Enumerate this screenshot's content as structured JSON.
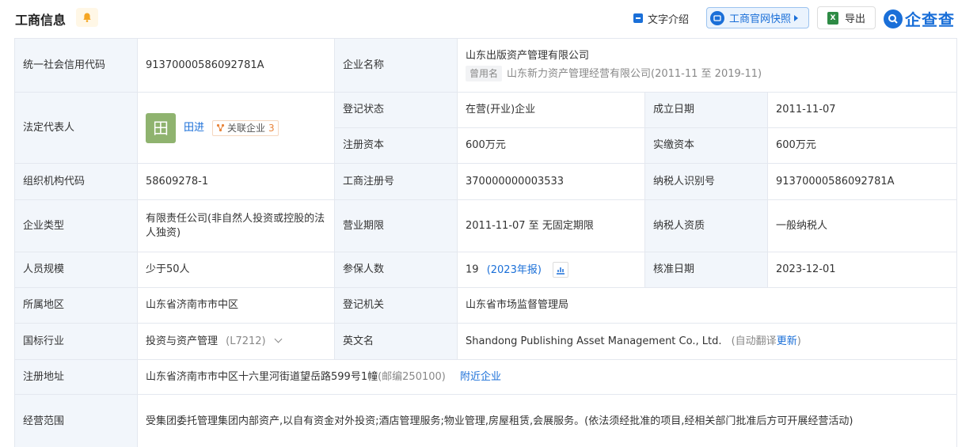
{
  "header": {
    "title": "工商信息",
    "text_intro": "文字介绍",
    "snapshot": "工商官网快照",
    "export": "导出",
    "brand": "企查查"
  },
  "rows": {
    "credit_code_label": "统一社会信用代码",
    "credit_code": "91370000586092781A",
    "company_name_label": "企业名称",
    "company_name": "山东出版资产管理有限公司",
    "former_tag": "曾用名",
    "former_name": "山东新力资产管理经营有限公司",
    "former_period": "(2011-11 至 2019-11)",
    "legal_rep_label": "法定代表人",
    "legal_rep_avatar": "田",
    "legal_rep_name": "田进",
    "related_label": "关联企业",
    "related_count": "3",
    "reg_status_label": "登记状态",
    "reg_status": "在营(开业)企业",
    "founded_label": "成立日期",
    "founded": "2011-11-07",
    "reg_capital_label": "注册资本",
    "reg_capital": "600万元",
    "paid_capital_label": "实缴资本",
    "paid_capital": "600万元",
    "org_code_label": "组织机构代码",
    "org_code": "58609278-1",
    "biz_reg_no_label": "工商注册号",
    "biz_reg_no": "370000000003533",
    "taxpayer_id_label": "纳税人识别号",
    "taxpayer_id": "91370000586092781A",
    "company_type_label": "企业类型",
    "company_type": "有限责任公司(非自然人投资或控股的法人独资)",
    "biz_term_label": "营业期限",
    "biz_term": "2011-11-07 至 无固定期限",
    "taxpayer_qual_label": "纳税人资质",
    "taxpayer_qual": "一般纳税人",
    "staff_size_label": "人员规模",
    "staff_size": "少于50人",
    "insured_label": "参保人数",
    "insured": "19",
    "insured_year": "(2023年报)",
    "approved_label": "核准日期",
    "approved": "2023-12-01",
    "region_label": "所属地区",
    "region": "山东省济南市市中区",
    "authority_label": "登记机关",
    "authority": "山东省市场监督管理局",
    "industry_label": "国标行业",
    "industry": "投资与资产管理",
    "industry_code": "(L7212)",
    "english_label": "英文名",
    "english_name": "Shandong Publishing Asset Management Co., Ltd.",
    "auto_translate": "(自动翻译",
    "update": "更新",
    "paren_close": ")",
    "address_label": "注册地址",
    "address": "山东省济南市市中区十六里河街道望岳路599号1幢",
    "postcode": "(邮编250100)",
    "nearby": "附近企业",
    "scope_label": "经营范围",
    "scope": "受集团委托管理集团内部资产,以自有资金对外投资;酒店管理服务;物业管理,房屋租赁,会展服务。(依法须经批准的项目,经相关部门批准后方可开展经营活动)"
  },
  "colors": {
    "accent": "#1a6fd8",
    "label_bg": "#f2f6fb",
    "border": "#e4e8ef",
    "avatar_bg": "#8fb36f",
    "related_count": "#e8843b"
  }
}
